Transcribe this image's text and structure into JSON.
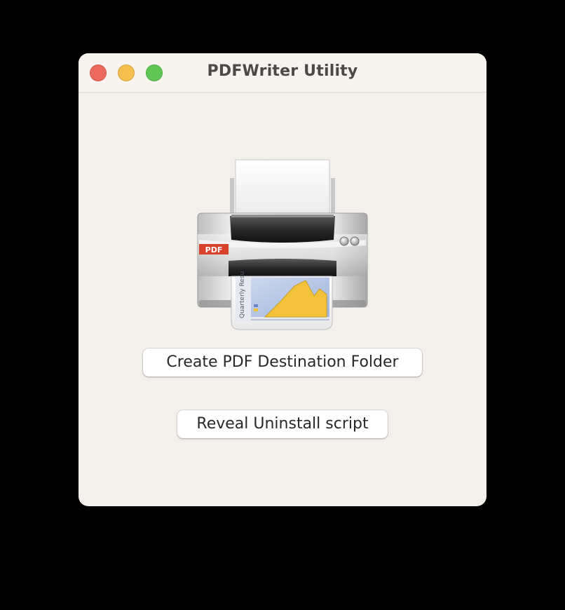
{
  "window": {
    "title": "PDFWriter Utility"
  },
  "icon": {
    "name": "pdf-printer-icon",
    "badge_text": "PDF",
    "paper_text": "Quarterly Resu"
  },
  "buttons": {
    "create_label": "Create PDF Destination Folder",
    "reveal_label": "Reveal Uninstall script"
  },
  "colors": {
    "close": "#ec6a5e",
    "minimize": "#f4bf4f",
    "zoom": "#61c554",
    "badge": "#d8412b"
  }
}
